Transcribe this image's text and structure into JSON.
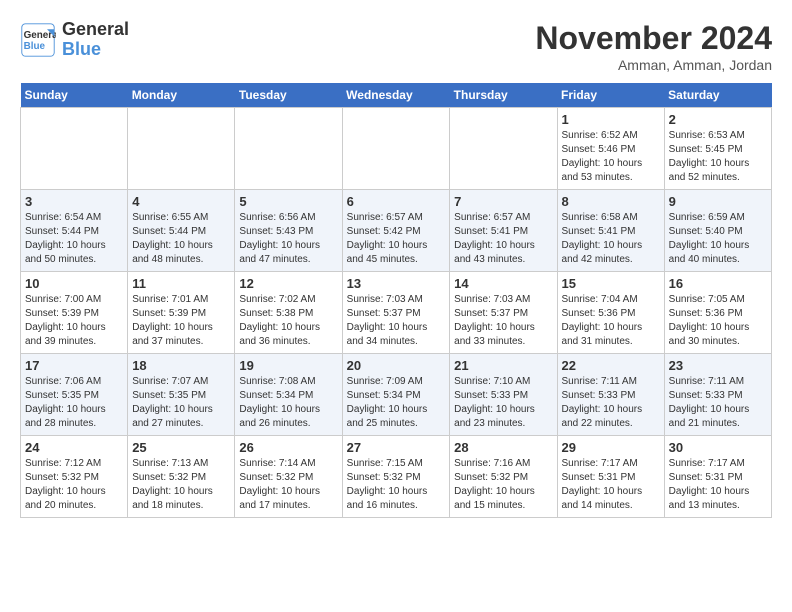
{
  "logo": {
    "line1": "General",
    "line2": "Blue"
  },
  "title": "November 2024",
  "location": "Amman, Amman, Jordan",
  "days_header": [
    "Sunday",
    "Monday",
    "Tuesday",
    "Wednesday",
    "Thursday",
    "Friday",
    "Saturday"
  ],
  "weeks": [
    [
      {
        "day": "",
        "info": ""
      },
      {
        "day": "",
        "info": ""
      },
      {
        "day": "",
        "info": ""
      },
      {
        "day": "",
        "info": ""
      },
      {
        "day": "",
        "info": ""
      },
      {
        "day": "1",
        "info": "Sunrise: 6:52 AM\nSunset: 5:46 PM\nDaylight: 10 hours\nand 53 minutes."
      },
      {
        "day": "2",
        "info": "Sunrise: 6:53 AM\nSunset: 5:45 PM\nDaylight: 10 hours\nand 52 minutes."
      }
    ],
    [
      {
        "day": "3",
        "info": "Sunrise: 6:54 AM\nSunset: 5:44 PM\nDaylight: 10 hours\nand 50 minutes."
      },
      {
        "day": "4",
        "info": "Sunrise: 6:55 AM\nSunset: 5:44 PM\nDaylight: 10 hours\nand 48 minutes."
      },
      {
        "day": "5",
        "info": "Sunrise: 6:56 AM\nSunset: 5:43 PM\nDaylight: 10 hours\nand 47 minutes."
      },
      {
        "day": "6",
        "info": "Sunrise: 6:57 AM\nSunset: 5:42 PM\nDaylight: 10 hours\nand 45 minutes."
      },
      {
        "day": "7",
        "info": "Sunrise: 6:57 AM\nSunset: 5:41 PM\nDaylight: 10 hours\nand 43 minutes."
      },
      {
        "day": "8",
        "info": "Sunrise: 6:58 AM\nSunset: 5:41 PM\nDaylight: 10 hours\nand 42 minutes."
      },
      {
        "day": "9",
        "info": "Sunrise: 6:59 AM\nSunset: 5:40 PM\nDaylight: 10 hours\nand 40 minutes."
      }
    ],
    [
      {
        "day": "10",
        "info": "Sunrise: 7:00 AM\nSunset: 5:39 PM\nDaylight: 10 hours\nand 39 minutes."
      },
      {
        "day": "11",
        "info": "Sunrise: 7:01 AM\nSunset: 5:39 PM\nDaylight: 10 hours\nand 37 minutes."
      },
      {
        "day": "12",
        "info": "Sunrise: 7:02 AM\nSunset: 5:38 PM\nDaylight: 10 hours\nand 36 minutes."
      },
      {
        "day": "13",
        "info": "Sunrise: 7:03 AM\nSunset: 5:37 PM\nDaylight: 10 hours\nand 34 minutes."
      },
      {
        "day": "14",
        "info": "Sunrise: 7:03 AM\nSunset: 5:37 PM\nDaylight: 10 hours\nand 33 minutes."
      },
      {
        "day": "15",
        "info": "Sunrise: 7:04 AM\nSunset: 5:36 PM\nDaylight: 10 hours\nand 31 minutes."
      },
      {
        "day": "16",
        "info": "Sunrise: 7:05 AM\nSunset: 5:36 PM\nDaylight: 10 hours\nand 30 minutes."
      }
    ],
    [
      {
        "day": "17",
        "info": "Sunrise: 7:06 AM\nSunset: 5:35 PM\nDaylight: 10 hours\nand 28 minutes."
      },
      {
        "day": "18",
        "info": "Sunrise: 7:07 AM\nSunset: 5:35 PM\nDaylight: 10 hours\nand 27 minutes."
      },
      {
        "day": "19",
        "info": "Sunrise: 7:08 AM\nSunset: 5:34 PM\nDaylight: 10 hours\nand 26 minutes."
      },
      {
        "day": "20",
        "info": "Sunrise: 7:09 AM\nSunset: 5:34 PM\nDaylight: 10 hours\nand 25 minutes."
      },
      {
        "day": "21",
        "info": "Sunrise: 7:10 AM\nSunset: 5:33 PM\nDaylight: 10 hours\nand 23 minutes."
      },
      {
        "day": "22",
        "info": "Sunrise: 7:11 AM\nSunset: 5:33 PM\nDaylight: 10 hours\nand 22 minutes."
      },
      {
        "day": "23",
        "info": "Sunrise: 7:11 AM\nSunset: 5:33 PM\nDaylight: 10 hours\nand 21 minutes."
      }
    ],
    [
      {
        "day": "24",
        "info": "Sunrise: 7:12 AM\nSunset: 5:32 PM\nDaylight: 10 hours\nand 20 minutes."
      },
      {
        "day": "25",
        "info": "Sunrise: 7:13 AM\nSunset: 5:32 PM\nDaylight: 10 hours\nand 18 minutes."
      },
      {
        "day": "26",
        "info": "Sunrise: 7:14 AM\nSunset: 5:32 PM\nDaylight: 10 hours\nand 17 minutes."
      },
      {
        "day": "27",
        "info": "Sunrise: 7:15 AM\nSunset: 5:32 PM\nDaylight: 10 hours\nand 16 minutes."
      },
      {
        "day": "28",
        "info": "Sunrise: 7:16 AM\nSunset: 5:32 PM\nDaylight: 10 hours\nand 15 minutes."
      },
      {
        "day": "29",
        "info": "Sunrise: 7:17 AM\nSunset: 5:31 PM\nDaylight: 10 hours\nand 14 minutes."
      },
      {
        "day": "30",
        "info": "Sunrise: 7:17 AM\nSunset: 5:31 PM\nDaylight: 10 hours\nand 13 minutes."
      }
    ]
  ]
}
